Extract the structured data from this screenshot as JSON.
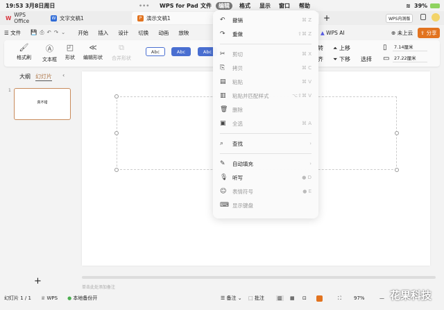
{
  "status": {
    "time": "19:53",
    "date": "3月8日周日",
    "app": "WPS for Pad",
    "menus": [
      "文件",
      "编辑",
      "格式",
      "显示",
      "窗口",
      "帮助"
    ],
    "battery": "39%"
  },
  "tabs": [
    {
      "label": "WPS Office",
      "icon": "wps-logo-icon",
      "color": "#d9363e"
    },
    {
      "label": "文字文稿1",
      "icon": "W",
      "color": "#2f6bd6"
    },
    {
      "label": "演示文稿1",
      "icon": "P",
      "color": "#e2731f"
    }
  ],
  "tabs_extra": {
    "badge": "WPS内测版",
    "cloud": "未上云",
    "share": "分享",
    "ai": "WPS AI"
  },
  "ribbon": {
    "file": "文件",
    "tabs": [
      "开始",
      "插入",
      "设计",
      "切换",
      "动画",
      "放映"
    ]
  },
  "toolbar": {
    "format_painter": "格式刷",
    "textbox": "文本框",
    "shape": "形状",
    "edit_shape": "编辑形状",
    "merge_shape": "合并形状",
    "styles": [
      "Abc",
      "Abc",
      "Abc"
    ],
    "rotate": "转",
    "align": "齐",
    "up": "上移",
    "down": "下移",
    "select": "选择",
    "width": "7.14厘米",
    "height": "27.22厘米"
  },
  "left": {
    "outline": "大纲",
    "slides": "幻灯片",
    "slide_number": "1",
    "thumb_text": "真不错"
  },
  "menu": {
    "items": [
      {
        "label": "撤销",
        "icon": "undo-icon",
        "glyph": "↶",
        "shortcut": "⌘ Z",
        "disabled": false
      },
      {
        "label": "重做",
        "icon": "redo-icon",
        "glyph": "↷",
        "shortcut": "⇧⌘ Z",
        "disabled": false
      },
      {
        "label": "剪切",
        "icon": "scissors-icon",
        "glyph": "✂",
        "shortcut": "⌘ X",
        "disabled": true
      },
      {
        "label": "拷贝",
        "icon": "copy-icon",
        "glyph": "⎘",
        "shortcut": "⌘ C",
        "disabled": true
      },
      {
        "label": "粘贴",
        "icon": "paste-icon",
        "glyph": "▤",
        "shortcut": "⌘ V",
        "disabled": true
      },
      {
        "label": "粘贴并匹配样式",
        "icon": "paste-style-icon",
        "glyph": "▥",
        "shortcut": "⌥⇧⌘ V",
        "disabled": true
      },
      {
        "label": "删除",
        "icon": "trash-icon",
        "glyph": "🗑",
        "shortcut": "",
        "disabled": true
      },
      {
        "label": "全选",
        "icon": "select-all-icon",
        "glyph": "▣",
        "shortcut": "⌘ A",
        "disabled": true
      },
      {
        "label": "查找",
        "icon": "find-icon",
        "glyph": "⌕",
        "shortcut": "›",
        "disabled": false
      },
      {
        "label": "自动填充",
        "icon": "autofill-icon",
        "glyph": "✎",
        "shortcut": "›",
        "disabled": false
      },
      {
        "label": "听写",
        "icon": "mic-icon",
        "glyph": "🎙",
        "shortcut": "● D",
        "disabled": false
      },
      {
        "label": "表情符号",
        "icon": "emoji-icon",
        "glyph": "☺",
        "shortcut": "● E",
        "disabled": true
      },
      {
        "label": "显示键盘",
        "icon": "keyboard-icon",
        "glyph": "⌨",
        "shortcut": "",
        "disabled": true
      }
    ]
  },
  "notes_placeholder": "单击此处添加备注",
  "bottom": {
    "slide_count": "幻灯片 1 / 1",
    "wps": "WPS",
    "backup": "本地备份开",
    "notes": "备注",
    "comments": "批注",
    "zoom": "97%"
  },
  "watermark": "花果科技",
  "colors": {
    "accent": "#e2731f",
    "blue": "#4a6fd1"
  }
}
